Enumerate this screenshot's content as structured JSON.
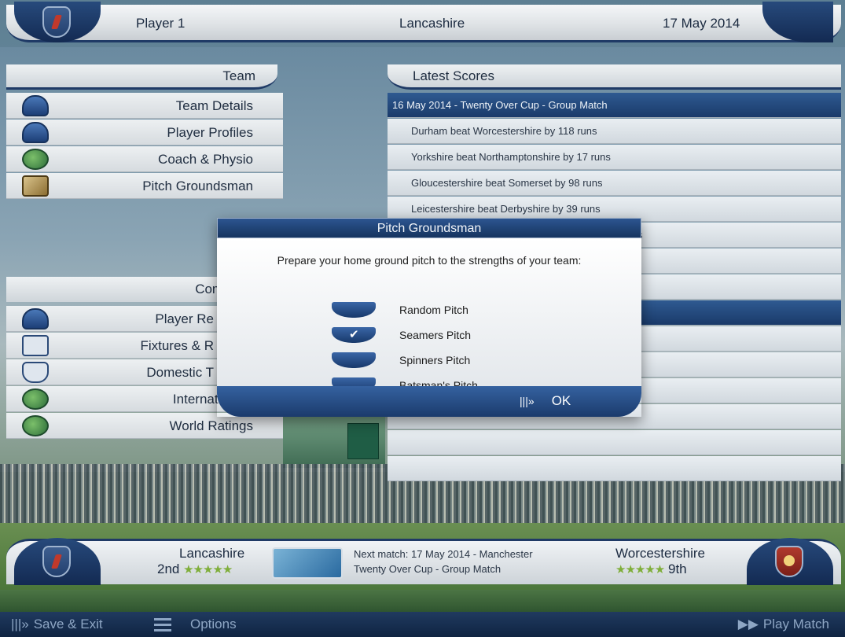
{
  "header": {
    "player": "Player 1",
    "club": "Lancashire",
    "date": "17 May 2014"
  },
  "team_section": {
    "title": "Team",
    "items": [
      {
        "label": "Team Details",
        "icon": "cap-icon"
      },
      {
        "label": "Player Profiles",
        "icon": "players-icon"
      },
      {
        "label": "Coach & Physio",
        "icon": "medical-icon"
      },
      {
        "label": "Pitch Groundsman",
        "icon": "bat-ball-icon"
      }
    ]
  },
  "competition_section": {
    "title": "Compe",
    "items": [
      {
        "label": "Player Re",
        "icon": "cap-stars-icon"
      },
      {
        "label": "Fixtures & R",
        "icon": "calendar-icon"
      },
      {
        "label": "Domestic T",
        "icon": "shield-icon"
      },
      {
        "label": "Internationals",
        "icon": "globe-icon"
      },
      {
        "label": "World Ratings",
        "icon": "globe-stars-icon"
      }
    ]
  },
  "scores": {
    "title": "Latest Scores",
    "rows": [
      {
        "text": "16 May 2014 - Twenty Over Cup - Group Match",
        "kind": "head"
      },
      {
        "text": "Durham beat Worcestershire by 118 runs",
        "kind": "row"
      },
      {
        "text": "Yorkshire beat Northamptonshire by 17 runs",
        "kind": "row"
      },
      {
        "text": "Gloucestershire beat Somerset by 98 runs",
        "kind": "row"
      },
      {
        "text": "Leicestershire beat Derbyshire by 39 runs",
        "kind": "row"
      },
      {
        "text": "s",
        "kind": "row"
      },
      {
        "text": "",
        "kind": "row"
      },
      {
        "text": "",
        "kind": "row"
      },
      {
        "text": "",
        "kind": "head"
      },
      {
        "text": "",
        "kind": "row"
      },
      {
        "text": "",
        "kind": "row"
      },
      {
        "text": "",
        "kind": "row"
      },
      {
        "text": "",
        "kind": "row"
      },
      {
        "text": "",
        "kind": "row"
      },
      {
        "text": "",
        "kind": "row"
      },
      {
        "text": "",
        "kind": "row"
      }
    ]
  },
  "next_match": {
    "home_team": "Lancashire",
    "home_position": "2nd",
    "home_stars": "★★★★★",
    "away_team": "Worcestershire",
    "away_position": "9th",
    "away_stars": "★★★★★",
    "line1": "Next match:  17 May 2014 - Manchester",
    "line2": "Twenty Over Cup - Group Match"
  },
  "bottom": {
    "save_exit": "Save & Exit",
    "options": "Options",
    "play_match": "Play Match"
  },
  "modal": {
    "title": "Pitch Groundsman",
    "prompt": "Prepare your home ground pitch to the strengths of your team:",
    "options": [
      {
        "label": "Random Pitch",
        "selected": false
      },
      {
        "label": "Seamers Pitch",
        "selected": true
      },
      {
        "label": "Spinners Pitch",
        "selected": false
      },
      {
        "label": "Batsman's Pitch",
        "selected": false
      }
    ],
    "ok_label": "OK"
  },
  "colors": {
    "accent_navy": "#1f3a66",
    "star_green": "#7fae3a",
    "header_blue": "#2f5a91"
  }
}
